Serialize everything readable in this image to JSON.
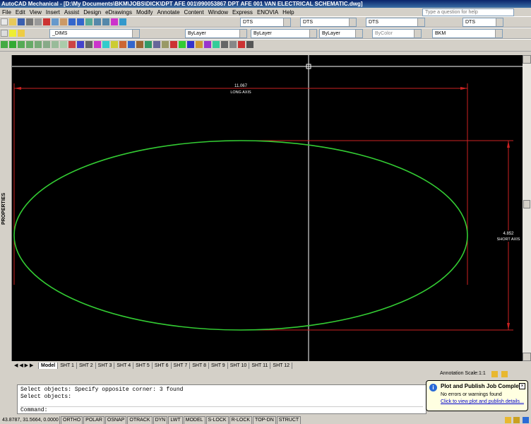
{
  "app": {
    "title": "AutoCAD Mechanical - [D:\\My Documents\\BKM\\JOBS\\DICK\\DPT AFE 001\\990053867 DPT AFE 001 VAN ELECTRICAL SCHEMATIC.dwg]"
  },
  "menu": {
    "items": [
      "File",
      "Edit",
      "View",
      "Insert",
      "Assist",
      "Design",
      "eDrawings",
      "Modify",
      "Annotate",
      "Content",
      "Window",
      "Express",
      "ENOVIA",
      "Help"
    ],
    "help_placeholder": "Type a question for help"
  },
  "toolbar": {
    "style1": "DTS",
    "style2": "DTS",
    "style3": "DTS",
    "style4": "DTS",
    "layer": "_DIMS",
    "color": "ByLayer",
    "linetype": "ByLayer",
    "lineweight": "ByLayer",
    "plotstyle": "ByColor",
    "plotstyle2": "BKM"
  },
  "sidebar": {
    "label": "PROPERTIES"
  },
  "drawing": {
    "long_axis_value": "11.067",
    "long_axis_label": "LONG AXIS",
    "short_axis_value": "4.852",
    "short_axis_label": "SHORT AXIS",
    "colors": {
      "background": "#000000",
      "ellipse": "#33cc33",
      "dimension": "#cc2222",
      "crosshair": "#ffffff"
    }
  },
  "tabs": [
    "Model",
    "SHT 1",
    "SHT 2",
    "SHT 3",
    "SHT 4",
    "SHT 5",
    "SHT 6",
    "SHT 7",
    "SHT 8",
    "SHT 9",
    "SHT 10",
    "SHT 11",
    "SHT 12"
  ],
  "status": {
    "annotation_scale_label": "Annotation Scale:",
    "annotation_scale_value": "1:1"
  },
  "command": {
    "lines": [
      "Select objects: Specify opposite corner: 3 found",
      "Select objects:"
    ],
    "prompt": "Command:"
  },
  "bottombar": {
    "coords": "43.8787, 31.5664, 0.0000",
    "buttons": [
      "ORTHO",
      "POLAR",
      "OSNAP",
      "OTRACK",
      "DYN",
      "LWT",
      "MODEL",
      "S-LOCK",
      "R-LOCK",
      "TOP-DN",
      "STRUCT"
    ]
  },
  "notification": {
    "title": "Plot and Publish Job Complete",
    "body": "No errors or warnings found",
    "link": "Click to view plot and publish details..."
  }
}
